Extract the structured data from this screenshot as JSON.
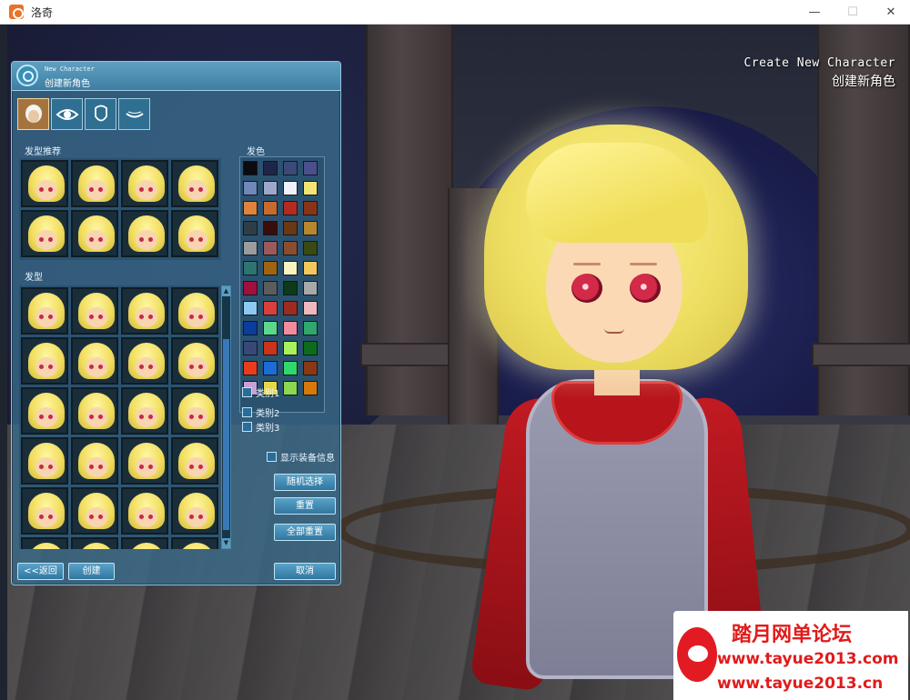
{
  "window": {
    "title": "洛奇",
    "minimize": "—",
    "maximize": "☐",
    "close": "✕"
  },
  "scene": {
    "title_en": "Create New Character",
    "title_cn": "创建新角色"
  },
  "panel": {
    "header_en": "New Character",
    "header_cn": "创建新角色",
    "tabs": [
      {
        "name": "hair",
        "icon": "hair-icon"
      },
      {
        "name": "eyes",
        "icon": "eye-icon"
      },
      {
        "name": "face",
        "icon": "face-icon"
      },
      {
        "name": "mouth",
        "icon": "mouth-icon"
      }
    ],
    "recommended_label": "发型推荐",
    "hairstyle_label": "发型",
    "hair_color_label": "发色",
    "categories": [
      "类别1",
      "类别2",
      "类别3"
    ],
    "show_equipment_label": "显示装备信息",
    "random_button": "随机选择",
    "reset_button": "重置",
    "reset_all_button": "全部重置",
    "back_button": "<<返回",
    "create_button": "创建",
    "cancel_button": "取消",
    "swatches": [
      "#0b0b10",
      "#1f2548",
      "#3b4a78",
      "#4c4f8c",
      "#6f88b8",
      "#9ea8cc",
      "#eef0fa",
      "#f2e472",
      "#e0823c",
      "#c86a2e",
      "#b32b1e",
      "#8a3416",
      "#2f3e46",
      "#3a0c0c",
      "#6a3812",
      "#b8862e",
      "#9c9c9c",
      "#9a5a5a",
      "#8a4e2e",
      "#3a4a12",
      "#2e7470",
      "#a06410",
      "#f8f2c0",
      "#f2c85c",
      "#a0103a",
      "#5c5c5c",
      "#0c3a1a",
      "#a8a8a8",
      "#8ec8f0",
      "#d8403c",
      "#9c2c20",
      "#f0b8bc",
      "#0c3c9c",
      "#5cd88c",
      "#f08c9c",
      "#30a86c",
      "#3a4878",
      "#c8341c",
      "#a8f05c",
      "#0c6c1c",
      "#e83c1c",
      "#1c6cd8",
      "#30d86c",
      "#8a3814",
      "#c8a0d8",
      "#e8d848",
      "#8cd850",
      "#d8780c"
    ]
  },
  "watermark": {
    "title": "踏月网单论坛",
    "url1": "www.tayue2013.com",
    "url2": "www.tayue2013.cn"
  }
}
